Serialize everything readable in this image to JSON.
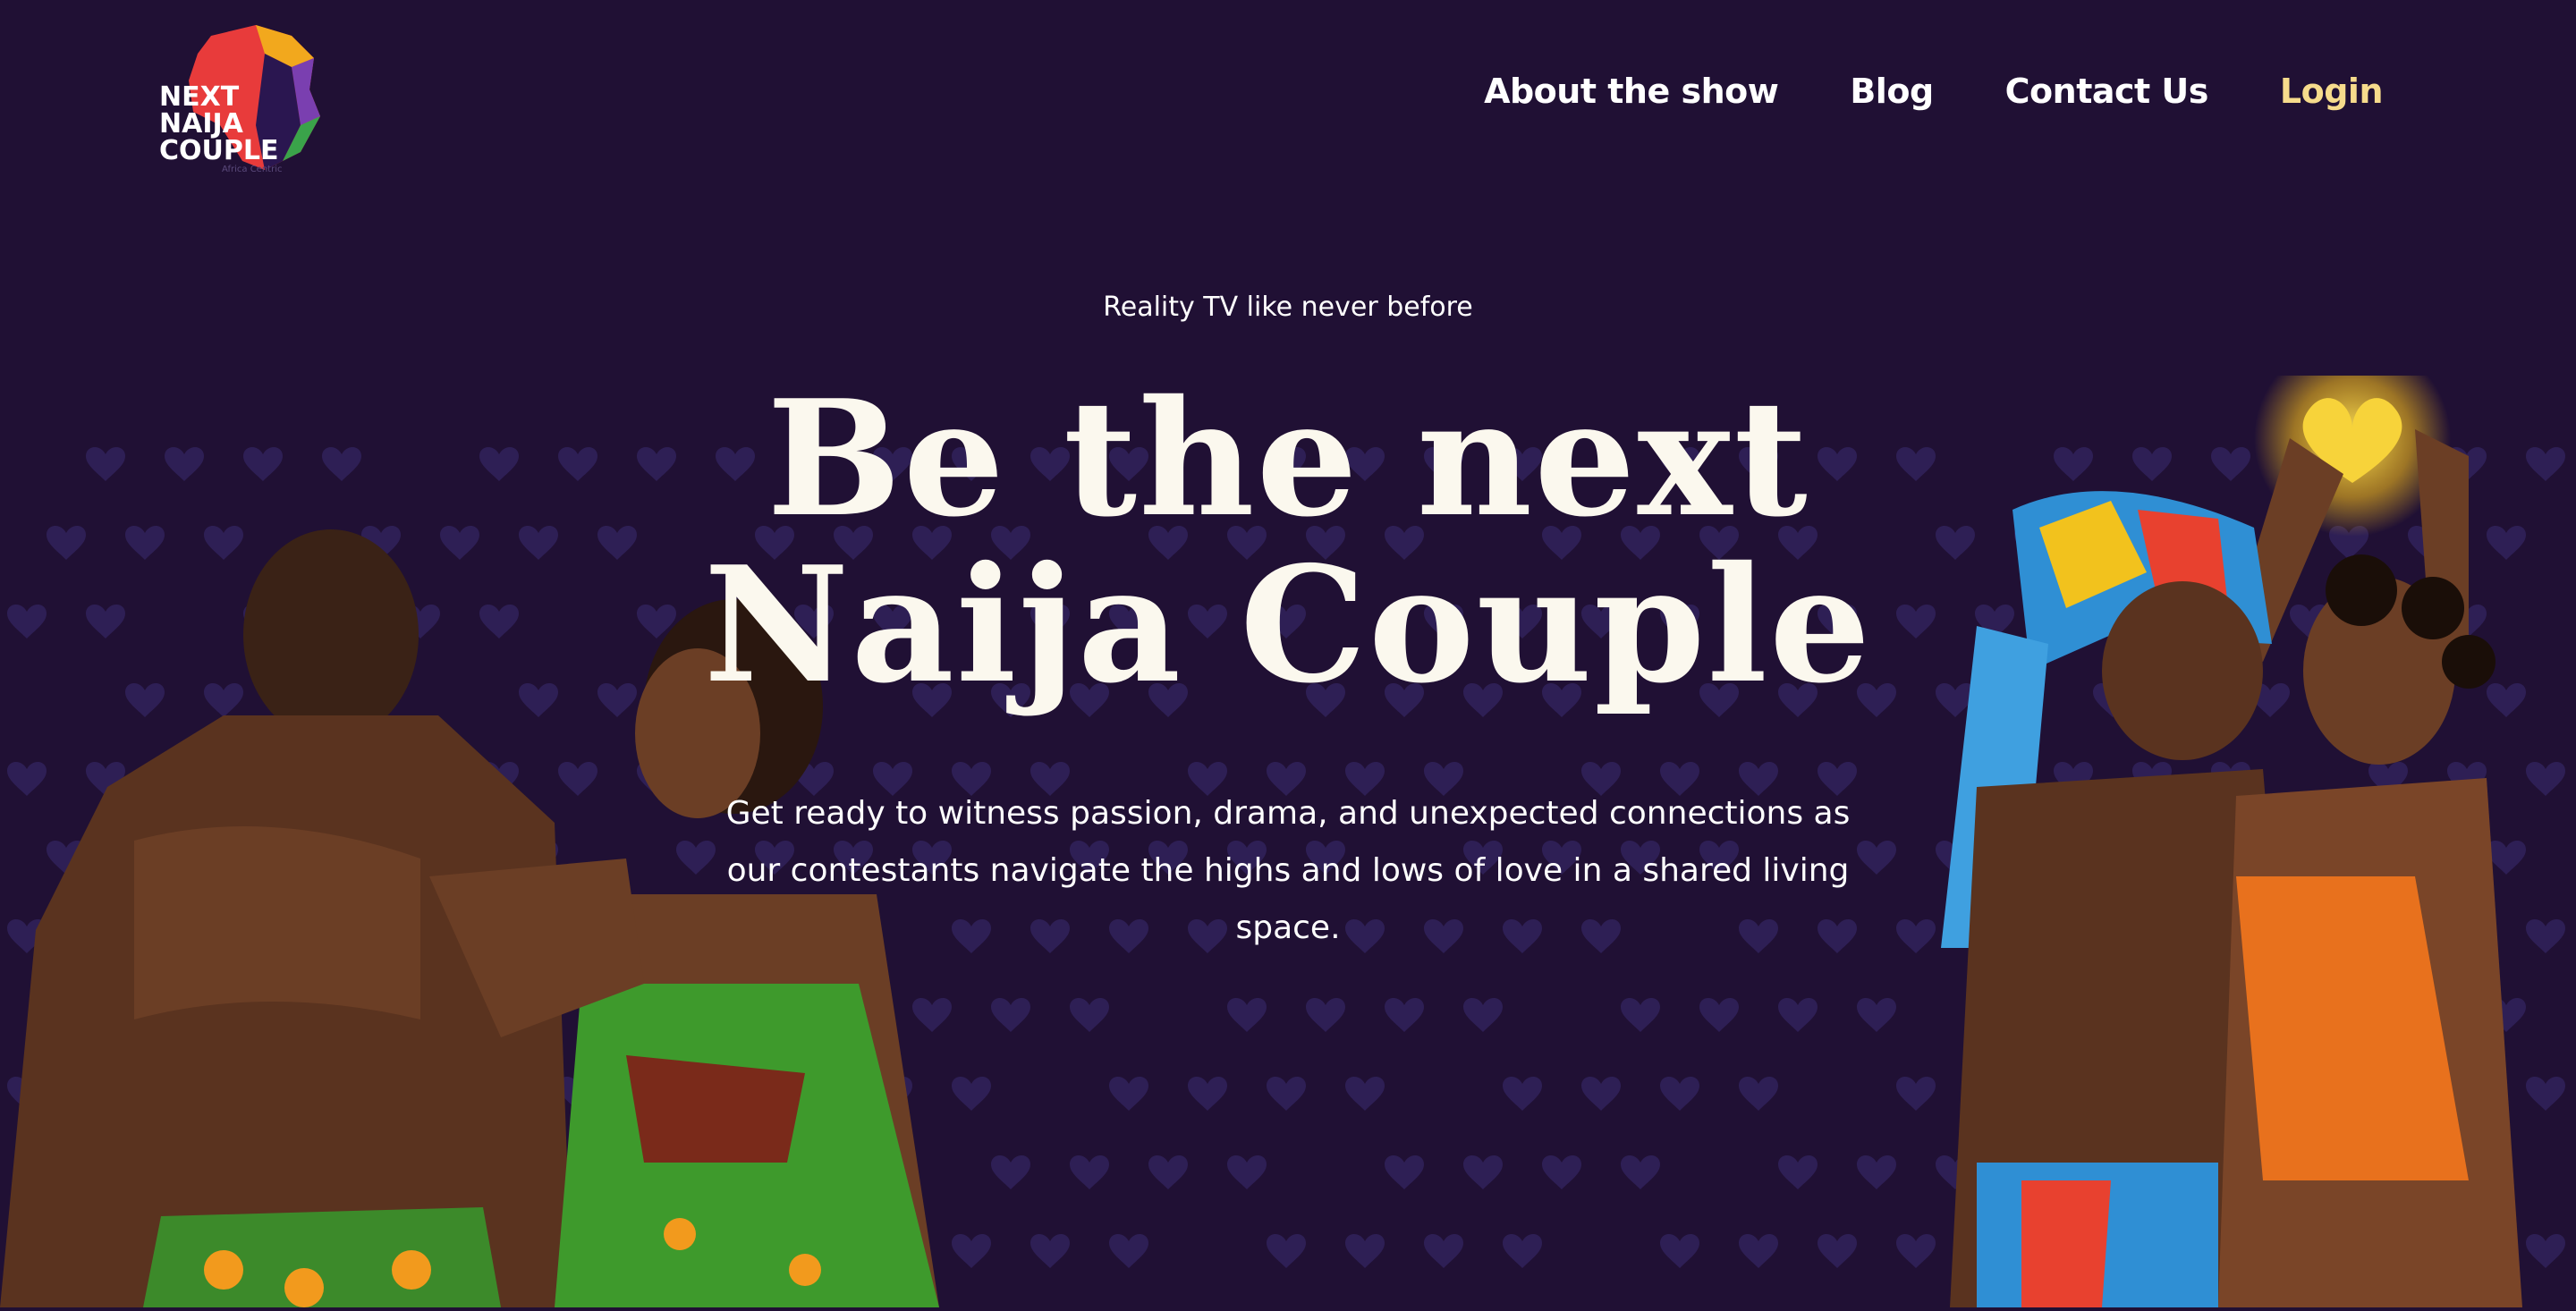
{
  "header": {
    "logo": {
      "lines": [
        "NEXT",
        "NAIJA",
        "COUPLE"
      ],
      "subtext": "Africa Centric"
    },
    "nav": [
      {
        "label": "About the show"
      },
      {
        "label": "Blog"
      },
      {
        "label": "Contact Us"
      },
      {
        "label": "Login"
      }
    ]
  },
  "hero": {
    "tagline": "Reality TV like never before",
    "headline_line1": "Be the next",
    "headline_line2": "Naija Couple",
    "description": "Get ready to witness passion, drama, and unexpected connections as our contestants navigate the highs and lows of love in a shared living space."
  },
  "colors": {
    "background": "#201034",
    "heart_pattern": "#2e1f55",
    "login_accent": "#f6db8c",
    "headline": "#fbf8ee"
  },
  "icons": [
    "heart-pattern-icon",
    "logo-africa-icon",
    "heart-hands-glow-icon"
  ]
}
